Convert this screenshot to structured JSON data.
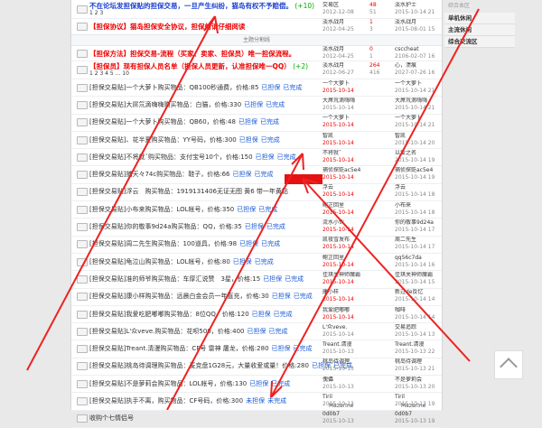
{
  "right_panel": {
    "top_link": "综合本区",
    "items": [
      "单机休闲",
      "主流休闲",
      "综合交流区"
    ]
  },
  "separator": "主题分割线",
  "pinned": [
    {
      "title": "不在论坛发担保贴的担保交易，一旦产生纠纷，猫岛有权不予赔偿。",
      "extra": "(+10)",
      "pager": "1 2 3",
      "style": "blue",
      "author": "交易区",
      "date": "2012-12-08",
      "replies": "48",
      "views": "51",
      "last_user": "淡水护士",
      "last_date": "2015-10-14 21"
    },
    {
      "title": "【担保协议】猫岛担保安全协议，担保前请仔细阅读",
      "extra": "",
      "pager": "",
      "style": "red",
      "author": "淡水战月",
      "date": "2012-04-25",
      "replies": "1",
      "views": "3",
      "last_user": "淡水战月",
      "last_date": "2015-08-01 15"
    },
    {
      "title": "【担保方法】担保交易-流程（买家、卖家、担保员）唯一担保流程。",
      "extra": "",
      "pager": "",
      "style": "red",
      "author": "淡水战月",
      "date": "2012-04-25",
      "replies": "0",
      "views": "1",
      "last_user": "csccheat",
      "last_date": "2106-02-07 16"
    },
    {
      "title": "【担保员】现有担保人员名单（担保人员更新，认准担保唯一QQ）",
      "extra": "(+2)",
      "pager": "1 2 3 4 5 ... 10",
      "style": "red",
      "author": "淡水战月",
      "date": "2012-06-27",
      "replies": "264",
      "views": "416",
      "last_user": "心，溃痕",
      "last_date": "2027-07-26 16"
    }
  ],
  "threads": [
    {
      "title": "[担保交易贴]一个大萝卜购买物品：QB100秒通费，价格:85",
      "t1": "已担保",
      "t2": "已完成",
      "author": "一个大萝卜",
      "date": "2015-10-14",
      "hot": true,
      "last_user": "一个大萝卜",
      "last_date": "2015-10-14 21"
    },
    {
      "title": "[担保交易贴]大屌氘滴嗨嗨购买物品：白猫，价格:330",
      "t1": "已担保",
      "t2": "已完成",
      "author": "大屌氘滴嗨嗨",
      "date": "2015-10-14",
      "hot": false,
      "last_user": "大屌氘滴嗨嗨",
      "last_date": "2015-10-14 21"
    },
    {
      "title": "[担保交易贴]一个大萝卜购买物品：QB60，价格:48",
      "t1": "已担保",
      "t2": "已完成",
      "author": "一个大萝卜",
      "date": "2015-10-14",
      "hot": true,
      "last_user": "一个大萝卜",
      "last_date": "2015-10-14 21"
    },
    {
      "title": "[担保交易贴]、花半夏购买物品：YY号码，价格:300",
      "t1": "已担保",
      "t2": "已完成",
      "author": "智凯",
      "date": "2015-10-14",
      "hot": true,
      "last_user": "智凯",
      "last_date": "2015-10-14 20"
    },
    {
      "title": "[担保交易贴]不将就ˇ购买物品：支付宝号10个，价格:150",
      "t1": "已担保",
      "t2": "已完成",
      "author": "不将就ˇ",
      "date": "2015-10-14",
      "hot": true,
      "last_user": "以爱之名",
      "last_date": "2015-10-14 19"
    },
    {
      "title": "[担保交易贴]捕天々74c购买物品：鞋子，价格:66",
      "t1": "已担保",
      "t2": "已完成",
      "author": "捕侦探贬ac5e4",
      "date": "2015-10-14",
      "hot": true,
      "last_user": "捕侦探贬ac5e4",
      "last_date": "2015-10-14 19"
    },
    {
      "title": "[担保交易贴]浮云　购买物品：1919131406无证无图 黄6 带一年黄钻",
      "t1": "",
      "t2": "",
      "author": "浮云",
      "date": "2015-10-14",
      "hot": true,
      "last_user": "浮云",
      "last_date": "2015-10-14 18"
    },
    {
      "title": "[担保交易贴]小布来购买物品：LOL帐号，价格:350",
      "t1": "已担保",
      "t2": "已完成",
      "author": "鲍芷回里",
      "date": "2015-10-14",
      "hot": true,
      "last_user": "小布来",
      "last_date": "2015-10-14 18"
    },
    {
      "title": "[担保交易贴]你的敬事9d24a购买物品：QQ，价格:35",
      "t1": "已担保",
      "t2": "已完成",
      "author": "流水小伙",
      "date": "2015-10-14",
      "hot": true,
      "last_user": "你的敬事9d24a",
      "last_date": "2015-10-14 17"
    },
    {
      "title": "[担保交易贴]周二先生购买物品：100道具，价格:98",
      "t1": "已担保",
      "t2": "已完成",
      "author": "凯夜雪发布",
      "date": "2015-10-14",
      "hot": true,
      "last_user": "周二先生",
      "last_date": "2015-10-14 17"
    },
    {
      "title": "[担保交易贴]龟泣山购买物品：LOL帐号，价格:80",
      "t1": "已担保",
      "t2": "已完成",
      "author": "鲍芷回里",
      "date": "2015-10-14",
      "hot": true,
      "last_user": "qq56c7da",
      "last_date": "2015-10-14 16"
    },
    {
      "title": "[担保交易贴]准的师爷购买物品：车厚汇说赞　3星，价格:15",
      "t1": "已担保",
      "t2": "已完成",
      "author": "佳琪关神师魔霸",
      "date": "2015-10-14",
      "hot": true,
      "last_user": "佳琪关神师魔霸",
      "last_date": "2015-10-14 15"
    },
    {
      "title": "[担保交易贴]康小样购买物品：远晨白金会员一年直充，价格:30",
      "t1": "已担保",
      "t2": "已完成",
      "author": "康小样",
      "date": "2015-10-14",
      "hot": true,
      "last_user": "新过de反忆",
      "last_date": "2015-10-14 14"
    },
    {
      "title": "[担保交易贴]我爱吃肥嘟嘟购买物品：8位QQ，价格:120",
      "t1": "已担保",
      "t2": "已完成",
      "author": "我爱肥嘟嘟",
      "date": "2015-10-14",
      "hot": true,
      "last_user": "咖啡",
      "last_date": "2015-10-14 14"
    },
    {
      "title": "[担保交易贴]L'众veve.购买物品：花呗500，价格:400",
      "t1": "已担保",
      "t2": "已完成",
      "author": "L'众veve.",
      "date": "2015-10-14",
      "hot": false,
      "last_user": "交易追踪",
      "last_date": "2015-10-14 13"
    },
    {
      "title": "[担保交易贴]Treant.清漫购买物品：CF号 雷神 屠龙，价格:280",
      "t1": "已担保",
      "t2": "已完成",
      "author": "Treant.清漫",
      "date": "2015-10-13",
      "hot": false,
      "last_user": "Treant.清漫",
      "last_date": "2015-10-13 22"
    },
    {
      "title": "[担保交易贴]桃岛待调理购买物品：麦克盘1G28元，大量收爱或量！价格:280",
      "t1": "已担保",
      "t2": "已完成",
      "author": "桃岛待调理",
      "date": "2015-10-13",
      "hot": false,
      "last_user": "桃岛待调理",
      "last_date": "2015-10-13 21"
    },
    {
      "title": "[担保交易贴]不是萝莉会购买物品：LOL帐号，价格:130",
      "t1": "已担保",
      "t2": "已完成",
      "author": "傀儡",
      "date": "2015-10-13",
      "hot": false,
      "last_user": "不是萝莉会",
      "last_date": "2015-10-13 20"
    },
    {
      "title": "[担保交易贴]执手不离，购买物品：CF号码，价格:300",
      "t1": "未担保",
      "t2": "未完成",
      "author": "Tiril",
      "date": "2015-10-13",
      "hot": false,
      "last_user": "Tiril",
      "last_date": "2015-10-13 19"
    },
    {
      "title": "收购个七情侣号",
      "t1": "",
      "t2": "",
      "author": "0d0b7",
      "date": "2015-10-13",
      "hot": false,
      "last_user": "0d0b7",
      "last_date": "2015-10-13 19"
    }
  ],
  "footer_left": "Mazarine",
  "footer_right": "Mazarine"
}
